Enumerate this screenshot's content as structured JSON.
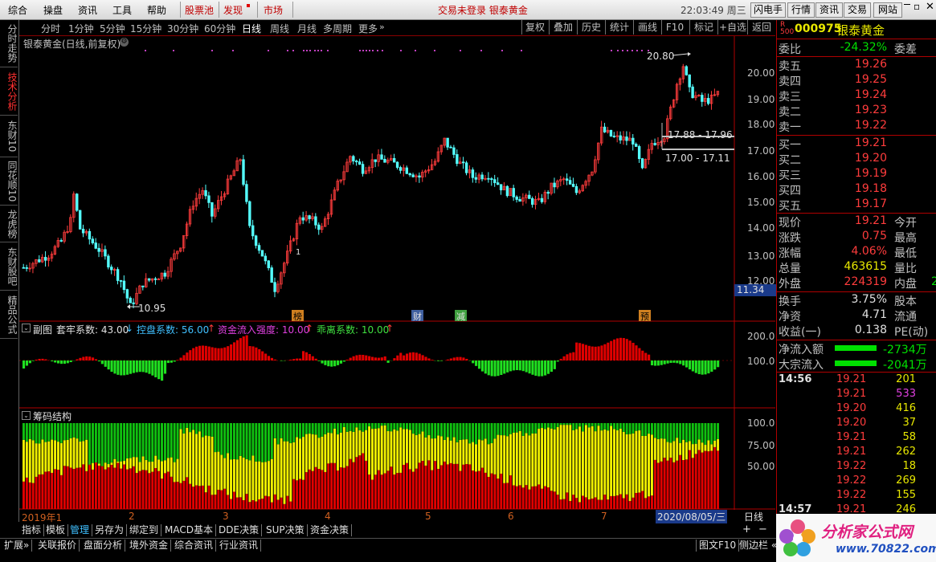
{
  "menu": {
    "items": [
      "综合",
      "操盘",
      "资讯",
      "工具",
      "帮助"
    ],
    "red_items": [
      "股票池",
      "发现",
      "市场"
    ],
    "status": "交易未登录  银泰黄金",
    "time": "22:03:49 周三",
    "right_buttons": [
      "闪电手",
      "行情",
      "资讯",
      "交易",
      "网站"
    ]
  },
  "left_tabs": [
    "分时走势",
    "技术分析",
    "东财10",
    "同花顺10",
    "龙虎榜",
    "东财股吧",
    "精品公式"
  ],
  "period_bar": {
    "periods": [
      "分时",
      "1分钟",
      "5分钟",
      "15分钟",
      "30分钟",
      "60分钟",
      "日线",
      "周线",
      "月线",
      "多周期",
      "更多"
    ],
    "selected": "日线",
    "tools": [
      "复权",
      "叠加",
      "历史",
      "统计",
      "画线",
      "F10",
      "标记",
      "+自选",
      "返回"
    ]
  },
  "chart": {
    "title": "银泰黄金(日线,前复权)",
    "y_labels": [
      "20.00",
      "19.00",
      "18.00",
      "17.00",
      "16.00",
      "15.00",
      "14.00",
      "13.00",
      "12.00"
    ],
    "current_price_label": "11.34",
    "high_label": "20.80",
    "low_label": "10.95",
    "zone1": "17.88 - 17.96",
    "zone2": "17.00 - 17.11",
    "markers": [
      "榜",
      "财",
      "减",
      "预"
    ],
    "marker_one": "1"
  },
  "sub1": {
    "name": "副图",
    "indicators": [
      {
        "label": "套牢系数: 43.00",
        "arrow": "↓"
      },
      {
        "label": "控盘系数: 56.00",
        "arrow": "↑"
      },
      {
        "label": "资金流入强度: 10.00",
        "arrow": "↑"
      },
      {
        "label": "乖离系数: 10.00",
        "arrow": "↑"
      }
    ],
    "y_labels": [
      "200.0",
      "100.0"
    ]
  },
  "sub2": {
    "name": "筹码结构",
    "y_labels": [
      "100.0",
      "75.00",
      "50.00"
    ]
  },
  "x_axis": {
    "labels": [
      "2019年1",
      "2",
      "3",
      "4",
      "5",
      "6",
      "7"
    ],
    "end_date": "2020/08/05/三",
    "period_btn": "日线"
  },
  "bottom_tabs1": [
    "指标",
    "模板",
    "管理",
    "另存为",
    "绑定到",
    "MACD基本",
    "DDE决策",
    "SUP决策",
    "资金决策"
  ],
  "bottom_tabs2": [
    "扩展»",
    "关联报价",
    "盘面分析",
    "境外资金",
    "综合资讯",
    "行业资讯"
  ],
  "bottom_right": [
    "图文F10",
    "侧边栏 «"
  ],
  "quote": {
    "code": "000975",
    "name": "银泰黄金",
    "weibi_label": "委比",
    "weibi": "-24.32%",
    "weicha_label": "委差",
    "asks": [
      {
        "label": "卖五",
        "price": "19.26"
      },
      {
        "label": "卖四",
        "price": "19.25"
      },
      {
        "label": "卖三",
        "price": "19.24"
      },
      {
        "label": "卖二",
        "price": "19.23"
      },
      {
        "label": "卖一",
        "price": "19.22"
      }
    ],
    "bids": [
      {
        "label": "买一",
        "price": "19.21"
      },
      {
        "label": "买二",
        "price": "19.20"
      },
      {
        "label": "买三",
        "price": "19.19"
      },
      {
        "label": "买四",
        "price": "19.18"
      },
      {
        "label": "买五",
        "price": "19.17"
      }
    ],
    "stats": [
      {
        "label": "现价",
        "value": "19.21",
        "label2": "今开",
        "color": "red"
      },
      {
        "label": "涨跌",
        "value": "0.75",
        "label2": "最高",
        "color": "red"
      },
      {
        "label": "涨幅",
        "value": "4.06%",
        "label2": "最低",
        "color": "red"
      },
      {
        "label": "总量",
        "value": "463615",
        "label2": "量比",
        "color": "yellow"
      },
      {
        "label": "外盘",
        "value": "224319",
        "label2": "内盘",
        "color": "red"
      }
    ],
    "neipan_partial": "2",
    "stats2": [
      {
        "label": "换手",
        "value": "3.75%",
        "label2": "股本"
      },
      {
        "label": "净资",
        "value": "4.71",
        "label2": "流通"
      },
      {
        "label": "收益(一)",
        "value": "0.138",
        "label2": "PE(动)"
      }
    ],
    "flows": [
      {
        "label": "净流入额",
        "value": "-2734万"
      },
      {
        "label": "大宗流入",
        "value": "-2041万"
      }
    ],
    "ticks": [
      {
        "time": "14:56",
        "price": "19.21",
        "vol": "201",
        "volcolor": "yellow"
      },
      {
        "time": "",
        "price": "19.21",
        "vol": "533",
        "volcolor": "magenta"
      },
      {
        "time": "",
        "price": "19.20",
        "vol": "416",
        "volcolor": "yellow"
      },
      {
        "time": "",
        "price": "19.20",
        "vol": "37",
        "volcolor": "yellow"
      },
      {
        "time": "",
        "price": "19.21",
        "vol": "58",
        "volcolor": "yellow"
      },
      {
        "time": "",
        "price": "19.21",
        "vol": "262",
        "volcolor": "yellow"
      },
      {
        "time": "",
        "price": "19.22",
        "vol": "18",
        "volcolor": "yellow"
      },
      {
        "time": "",
        "price": "19.22",
        "vol": "269",
        "volcolor": "yellow"
      },
      {
        "time": "",
        "price": "19.22",
        "vol": "155",
        "volcolor": "yellow"
      },
      {
        "time": "14:57",
        "price": "19.21",
        "vol": "246",
        "volcolor": "yellow"
      }
    ]
  },
  "watermark": {
    "title": "分析家公式网",
    "url": "www.70822.com"
  }
}
